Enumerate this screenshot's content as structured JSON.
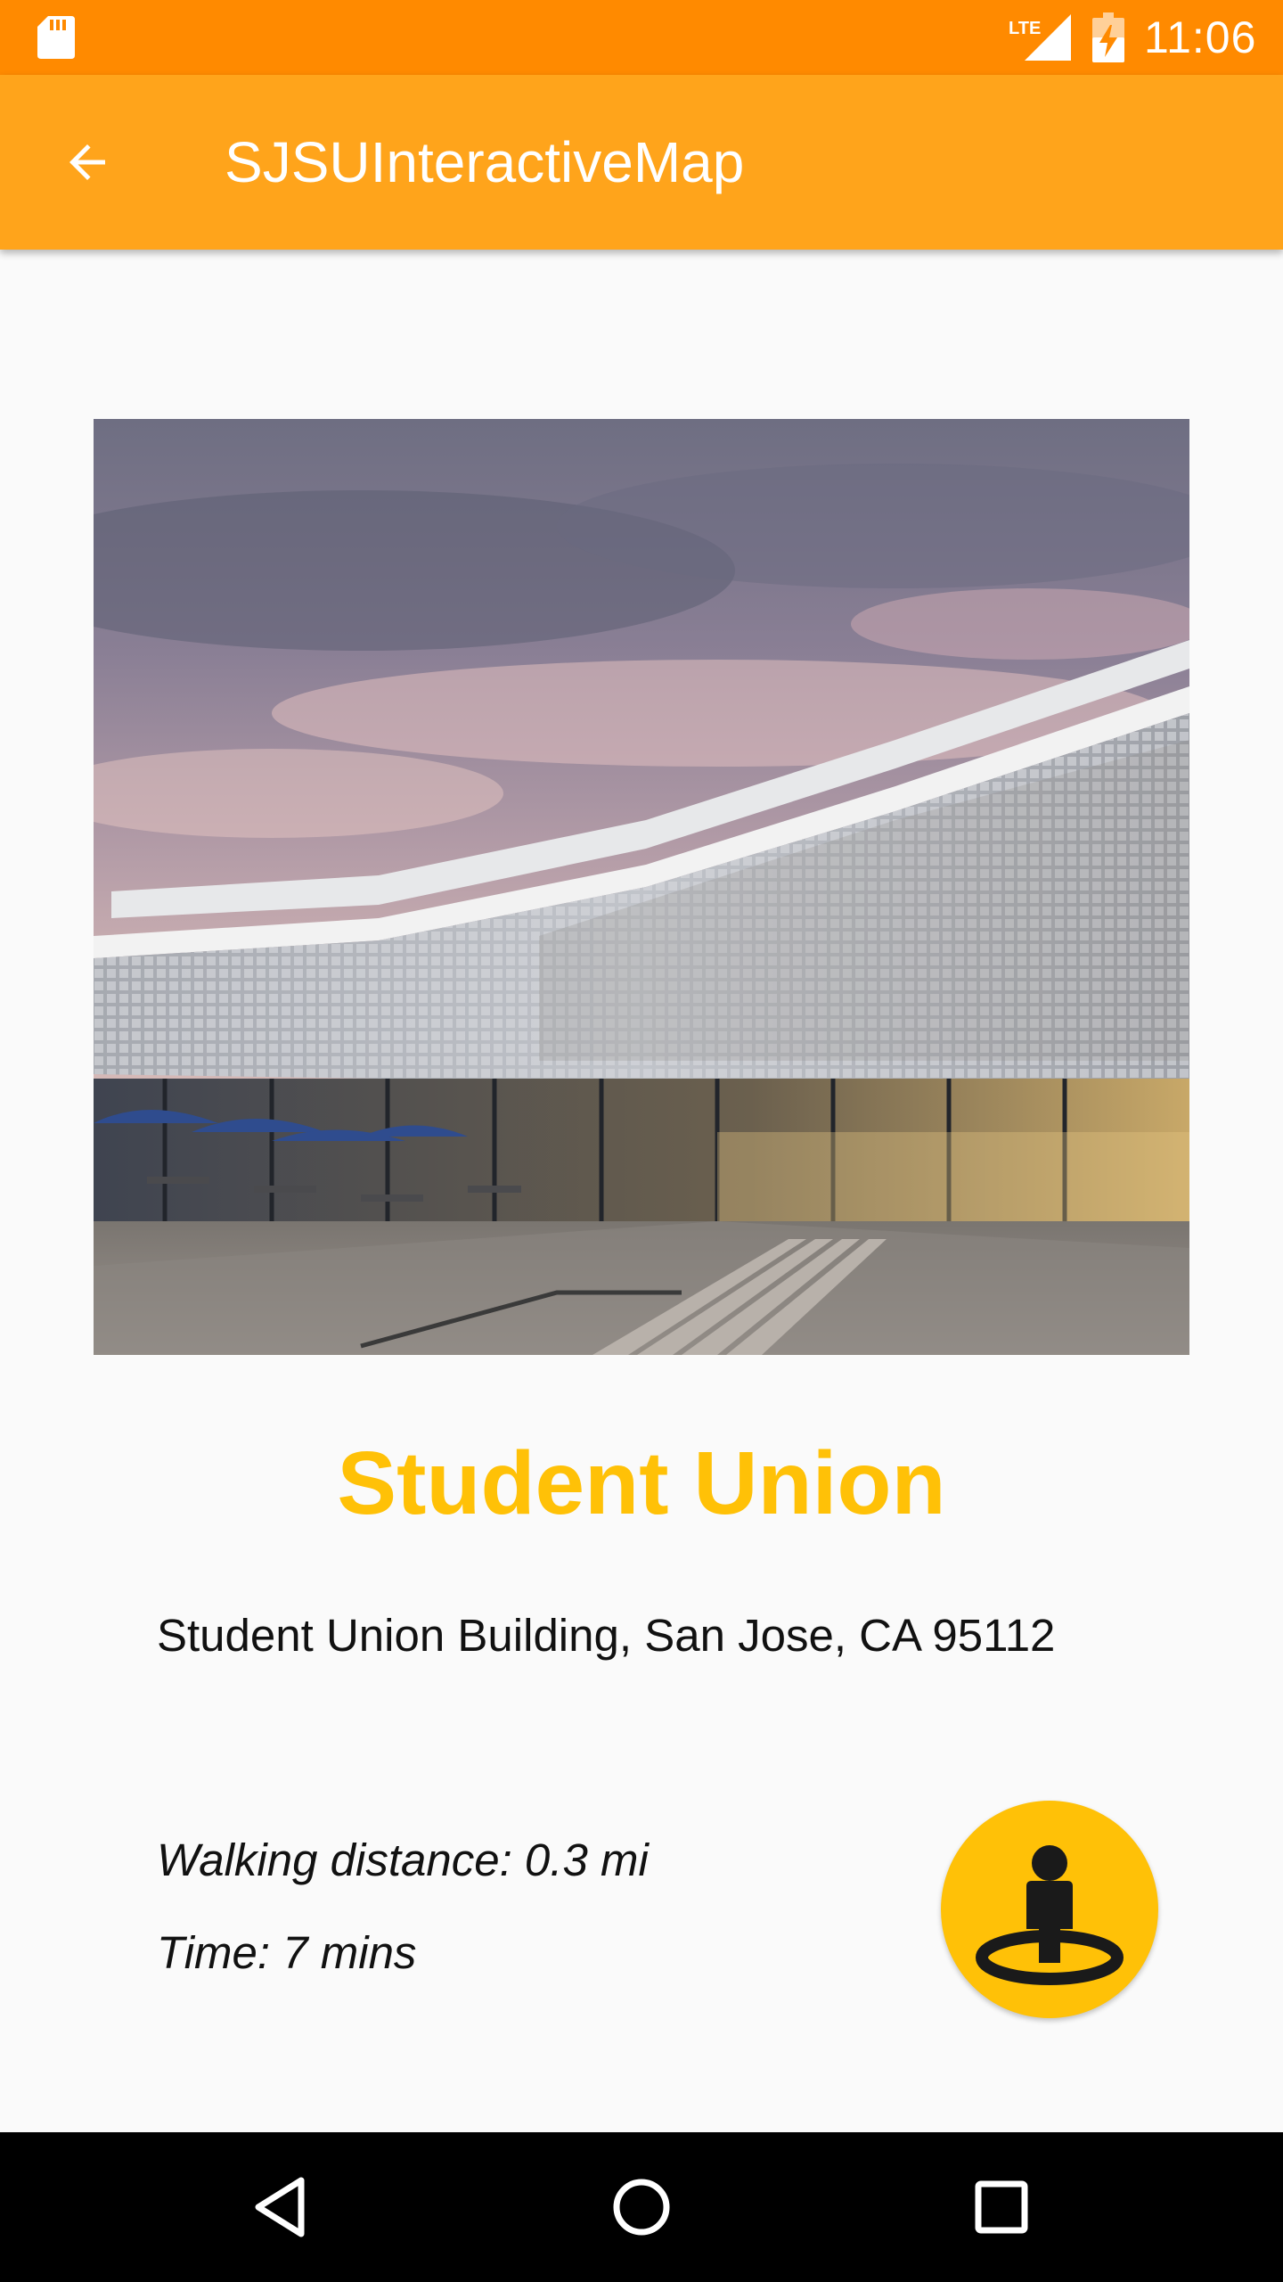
{
  "status_bar": {
    "time": "11:06",
    "network_label": "LTE",
    "icons": [
      "sd-card-icon",
      "lte-signal-icon",
      "battery-charging-icon"
    ]
  },
  "app_bar": {
    "title": "SJSUInteractiveMap",
    "back_icon": "arrow-back-icon"
  },
  "building": {
    "name": "Student Union",
    "address": "Student Union Building, San Jose, CA 95112",
    "walking_distance": "Walking distance: 0.3 mi",
    "walking_time": "Time: 7 mins",
    "photo_subject": "student-union-building-photo",
    "streetview_icon": "street-view-person-icon"
  },
  "nav_bar": {
    "icons": [
      "nav-back-icon",
      "nav-home-icon",
      "nav-recents-icon"
    ]
  },
  "colors": {
    "status_bar": "#FF8A00",
    "app_bar": "#FFA41B",
    "accent": "#FFC107",
    "background": "#FAFAFA",
    "nav_bar": "#000000"
  }
}
